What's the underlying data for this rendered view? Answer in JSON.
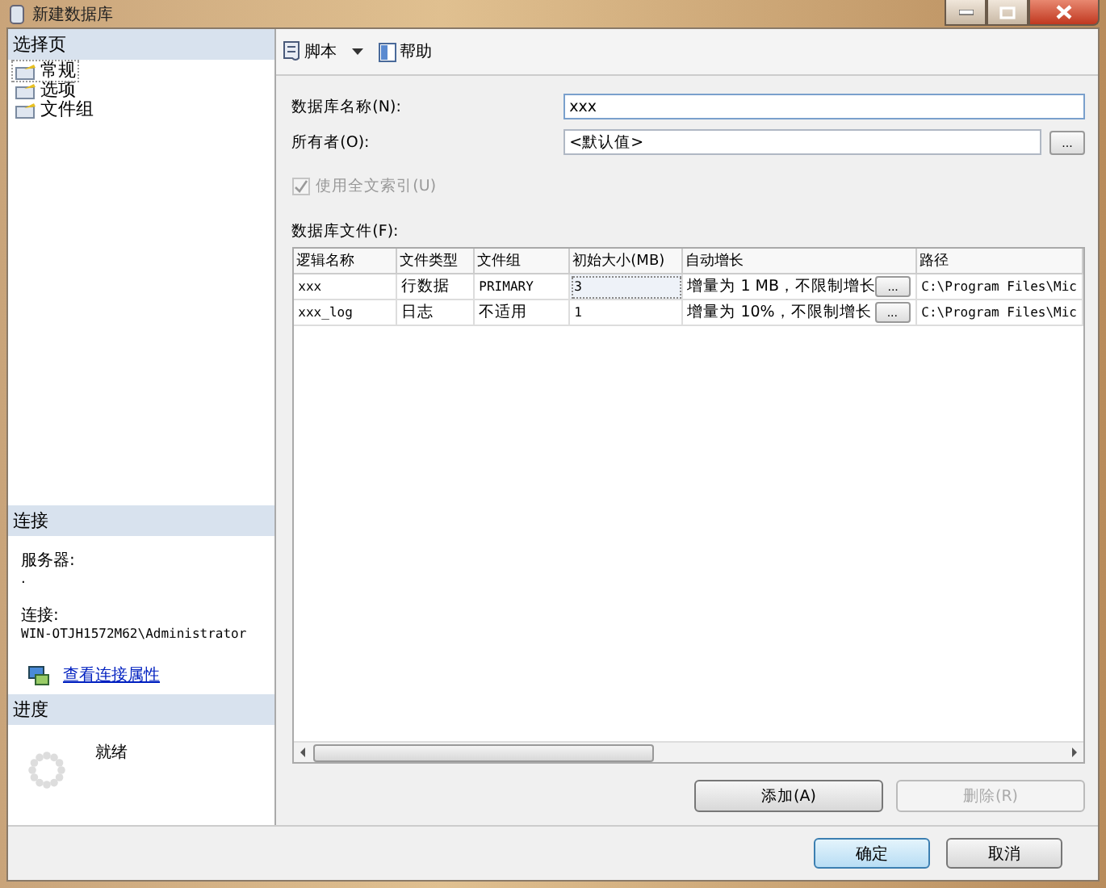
{
  "window": {
    "title": "新建数据库"
  },
  "sidebar": {
    "header": "选择页",
    "pages": [
      {
        "label": "常规",
        "selected": true
      },
      {
        "label": "选项",
        "selected": false
      },
      {
        "label": "文件组",
        "selected": false
      }
    ]
  },
  "connection": {
    "header": "连接",
    "server_label": "服务器:",
    "server_value": ".",
    "connection_label": "连接:",
    "connection_value": "WIN-OTJH1572M62\\Administrator",
    "link": "查看连接属性"
  },
  "progress": {
    "header": "进度",
    "status": "就绪"
  },
  "toolbar": {
    "script": "脚本",
    "help": "帮助"
  },
  "form": {
    "name_label": "数据库名称(N):",
    "name_value": "xxx",
    "owner_label": "所有者(O):",
    "owner_value": "<默认值>",
    "browse": "...",
    "fulltext": {
      "label": "使用全文索引(U)",
      "checked": true,
      "disabled": true
    }
  },
  "files": {
    "label": "数据库文件(F):",
    "columns": [
      "逻辑名称",
      "文件类型",
      "文件组",
      "初始大小(MB)",
      "自动增长",
      "路径"
    ],
    "rows": [
      {
        "cells": [
          "xxx",
          "行数据",
          "PRIMARY",
          "3",
          "增量为 1 MB，不限制增长",
          "C:\\Program Files\\Mic"
        ],
        "selected": true
      },
      {
        "cells": [
          "xxx_log",
          "日志",
          "不适用",
          "1",
          "增量为 10%，不限制增长",
          "C:\\Program Files\\Mic"
        ],
        "selected": false
      }
    ],
    "ellipsis": "..."
  },
  "buttons": {
    "add": {
      "label": "添加(A)",
      "disabled": false
    },
    "remove": {
      "label": "删除(R)",
      "disabled": true
    },
    "ok": "确定",
    "cancel": "取消"
  }
}
